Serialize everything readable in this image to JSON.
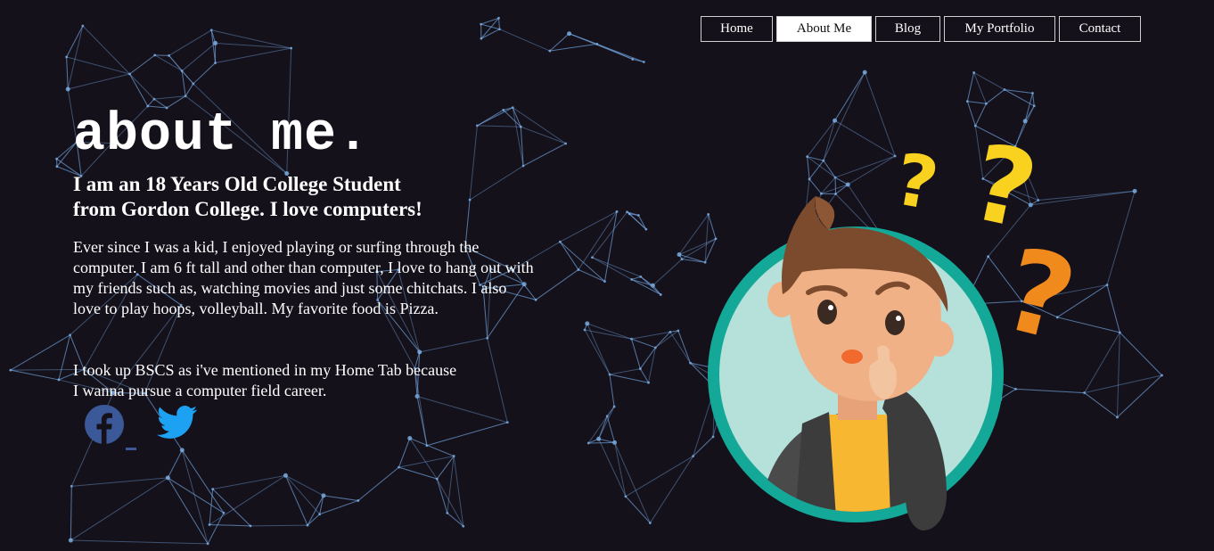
{
  "nav": {
    "items": [
      {
        "label": "Home"
      },
      {
        "label": "About Me",
        "active": true
      },
      {
        "label": "Blog"
      },
      {
        "label": "My Portfolio"
      },
      {
        "label": "Contact"
      }
    ]
  },
  "hero": {
    "title": "about me.",
    "subtitle_line1": "I am an 18 Years Old College Student",
    "subtitle_line2": "from Gordon College. I love computers!",
    "paragraph1": "Ever since I was a kid, I enjoyed playing or surfing through the computer. I am 6 ft tall and other than computer, I love to hang out with my friends such as, watching movies and just some chitchats. I also love to play hoops, volleyball. My favorite food is Pizza.",
    "paragraph2_line1": "I took up BSCS as i've mentioned in my Home Tab because",
    "paragraph2_line2": "I wanna pursue a computer field career."
  },
  "social": {
    "icons": [
      "facebook-icon",
      "twitter-icon"
    ]
  },
  "colors": {
    "background": "#15111b",
    "network_line": "#6f9fd8",
    "facebook": "#3b5998",
    "twitter": "#1da1f2",
    "ring": "#13a898",
    "question_yellow": "#f9d21f",
    "question_orange": "#f18a1d"
  }
}
